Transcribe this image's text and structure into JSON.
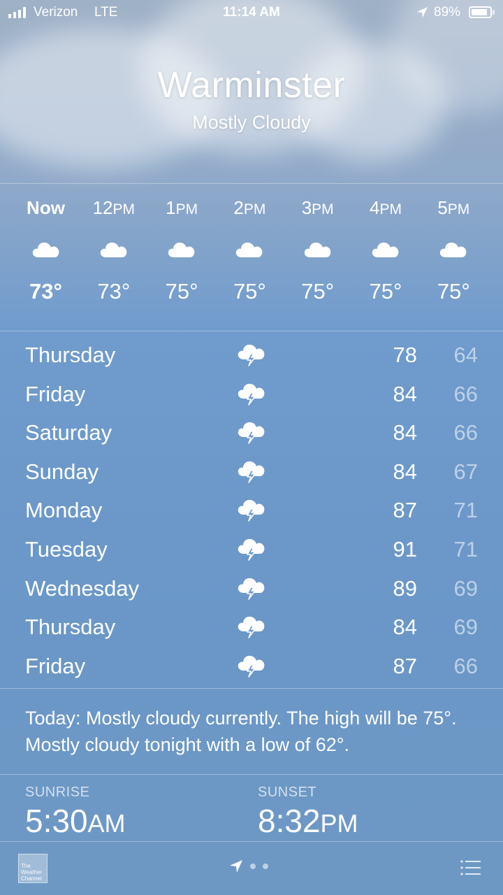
{
  "status_bar": {
    "carrier": "Verizon",
    "network": "LTE",
    "time": "11:14 AM",
    "battery": "89%",
    "battery_level": 0.89
  },
  "location": {
    "city": "Warminster",
    "condition": "Mostly Cloudy"
  },
  "hourly": [
    {
      "time": "Now",
      "icon": "cloud-icon",
      "temp": "73°"
    },
    {
      "time": "12PM",
      "icon": "cloud-icon",
      "temp": "73°"
    },
    {
      "time": "1PM",
      "icon": "cloud-icon",
      "temp": "75°"
    },
    {
      "time": "2PM",
      "icon": "cloud-icon",
      "temp": "75°"
    },
    {
      "time": "3PM",
      "icon": "cloud-icon",
      "temp": "75°"
    },
    {
      "time": "4PM",
      "icon": "cloud-icon",
      "temp": "75°"
    },
    {
      "time": "5PM",
      "icon": "cloud-icon",
      "temp": "75°"
    }
  ],
  "daily": [
    {
      "day": "Thursday",
      "icon": "thunderstorm-icon",
      "high": "78",
      "low": "64"
    },
    {
      "day": "Friday",
      "icon": "thunderstorm-icon",
      "high": "84",
      "low": "66"
    },
    {
      "day": "Saturday",
      "icon": "thunderstorm-icon",
      "high": "84",
      "low": "66"
    },
    {
      "day": "Sunday",
      "icon": "thunderstorm-icon",
      "high": "84",
      "low": "67"
    },
    {
      "day": "Monday",
      "icon": "thunderstorm-icon",
      "high": "87",
      "low": "71"
    },
    {
      "day": "Tuesday",
      "icon": "thunderstorm-icon",
      "high": "91",
      "low": "71"
    },
    {
      "day": "Wednesday",
      "icon": "thunderstorm-icon",
      "high": "89",
      "low": "69"
    },
    {
      "day": "Thursday",
      "icon": "thunderstorm-icon",
      "high": "84",
      "low": "69"
    },
    {
      "day": "Friday",
      "icon": "thunderstorm-icon",
      "high": "87",
      "low": "66"
    }
  ],
  "summary": "Today: Mostly cloudy currently. The high will be 75°. Mostly cloudy tonight with a low of 62°.",
  "sun": {
    "sunrise_label": "SUNRISE",
    "sunrise_time": "5:30",
    "sunrise_ampm": "AM",
    "sunset_label": "SUNSET",
    "sunset_time": "8:32",
    "sunset_ampm": "PM"
  },
  "bottom_bar": {
    "logo_text": "The Weather Channel",
    "page_count": 2
  },
  "colors": {
    "sky_top": "#9fb1c6",
    "sky_bottom": "#6e98c4",
    "text": "#ffffff",
    "low_temp": "rgba(255,255,255,0.55)"
  }
}
